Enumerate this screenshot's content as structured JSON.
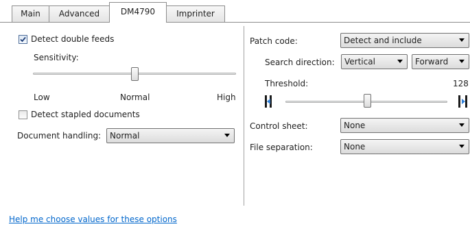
{
  "tabs": [
    "Main",
    "Advanced",
    "DM4790",
    "Imprinter"
  ],
  "active_tab": "DM4790",
  "left": {
    "detect_double_feeds": {
      "label": "Detect double feeds",
      "checked": true
    },
    "sensitivity": {
      "label": "Sensitivity:",
      "low": "Low",
      "normal": "Normal",
      "high": "High",
      "level": 0.5
    },
    "detect_stapled": {
      "label": "Detect stapled documents",
      "checked": false
    },
    "document_handling": {
      "label": "Document handling:",
      "value": "Normal"
    }
  },
  "right": {
    "patch_code": {
      "label": "Patch code:",
      "value": "Detect and include"
    },
    "search_direction": {
      "label": "Search direction:",
      "direction": "Vertical",
      "order": "Forward"
    },
    "threshold": {
      "label": "Threshold:",
      "value": "128"
    },
    "control_sheet": {
      "label": "Control sheet:",
      "value": "None"
    },
    "file_separation": {
      "label": "File separation:",
      "value": "None"
    }
  },
  "help_link": "Help me choose values for these options"
}
